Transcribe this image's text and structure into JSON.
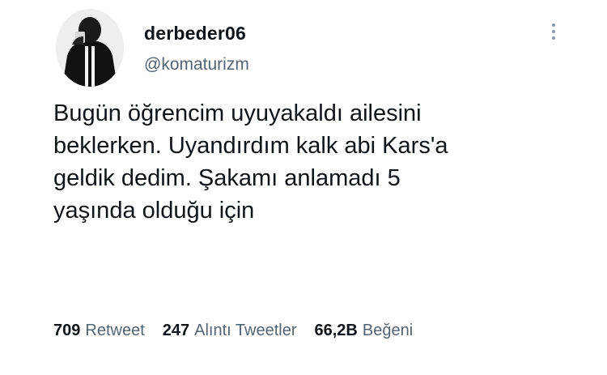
{
  "user": {
    "display_name": "derbeder06",
    "handle": "@komaturizm"
  },
  "tweet": {
    "lines": [
      "Bugün öğrencim uyuyakaldı ailesini",
      "beklerken. Uyandırdım kalk abi Kars'a",
      "geldik dedim. Şakamı anlamadı 5",
      "yaşında olduğu için"
    ]
  },
  "stats": {
    "retweets": {
      "count": "709",
      "label": "Retweet"
    },
    "quotes": {
      "count": "247",
      "label": "Alıntı Tweetler"
    },
    "likes": {
      "count": "66,2B",
      "label": "Beğeni"
    }
  },
  "icons": {
    "more": "more-vertical-icon",
    "avatar": "avatar-image"
  },
  "colors": {
    "text_primary": "#0f1419",
    "text_secondary": "#536471"
  }
}
